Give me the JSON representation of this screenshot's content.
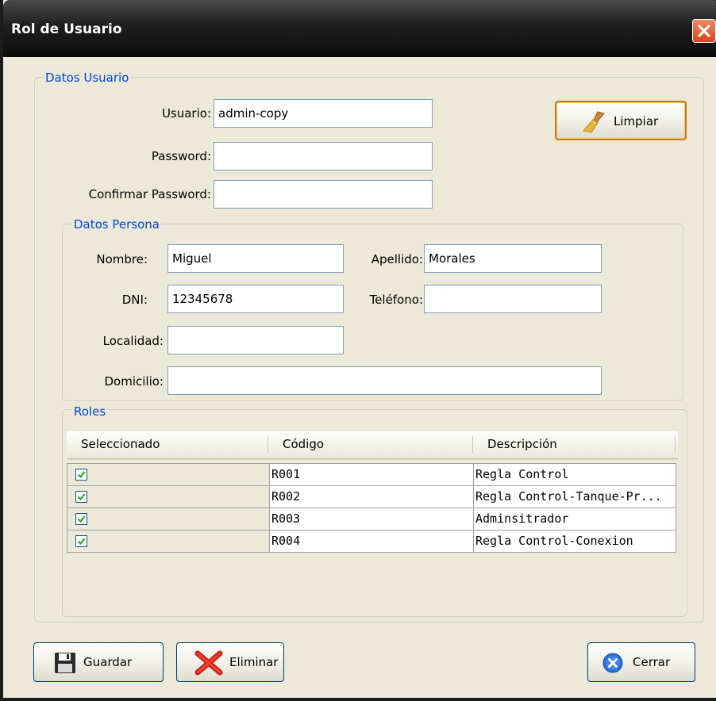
{
  "window": {
    "title": "Rol de Usuario"
  },
  "datos_usuario": {
    "legend": "Datos Usuario",
    "usuario_label": "Usuario:",
    "usuario_value": "admin-copy",
    "password_label": "Password:",
    "password_value": "",
    "confirmar_label": "Confirmar Password:",
    "confirmar_value": "",
    "limpiar_label": "Limpiar"
  },
  "datos_persona": {
    "legend": "Datos Persona",
    "nombre_label": "Nombre:",
    "nombre_value": "Miguel",
    "apellido_label": "Apellido:",
    "apellido_value": "Morales",
    "dni_label": "DNI:",
    "dni_value": "12345678",
    "telefono_label": "Teléfono:",
    "telefono_value": "",
    "localidad_label": "Localidad:",
    "localidad_value": "",
    "domicilio_label": "Domicilio:",
    "domicilio_value": ""
  },
  "roles": {
    "legend": "Roles",
    "columns": [
      "Seleccionado",
      "Código",
      "Descripción"
    ],
    "rows": [
      {
        "selected": true,
        "codigo": "R001",
        "descripcion": "Regla Control"
      },
      {
        "selected": true,
        "codigo": "R002",
        "descripcion": "Regla Control-Tanque-Pr..."
      },
      {
        "selected": true,
        "codigo": "R003",
        "descripcion": "Adminsitrador"
      },
      {
        "selected": true,
        "codigo": "R004",
        "descripcion": "Regla Control-Conexion"
      }
    ]
  },
  "buttons": {
    "guardar": "Guardar",
    "eliminar": "Eliminar",
    "cerrar": "Cerrar"
  },
  "icons": {
    "close": "close-icon",
    "limpiar": "broom-icon",
    "guardar": "floppy-disk-icon",
    "eliminar": "red-x-icon",
    "cerrar": "blue-circle-x-icon",
    "checkbox": "check-icon"
  },
  "colors": {
    "legend_text": "#0046d5",
    "close_button": "#d9441c",
    "limpiar_border": "#c77c10"
  }
}
